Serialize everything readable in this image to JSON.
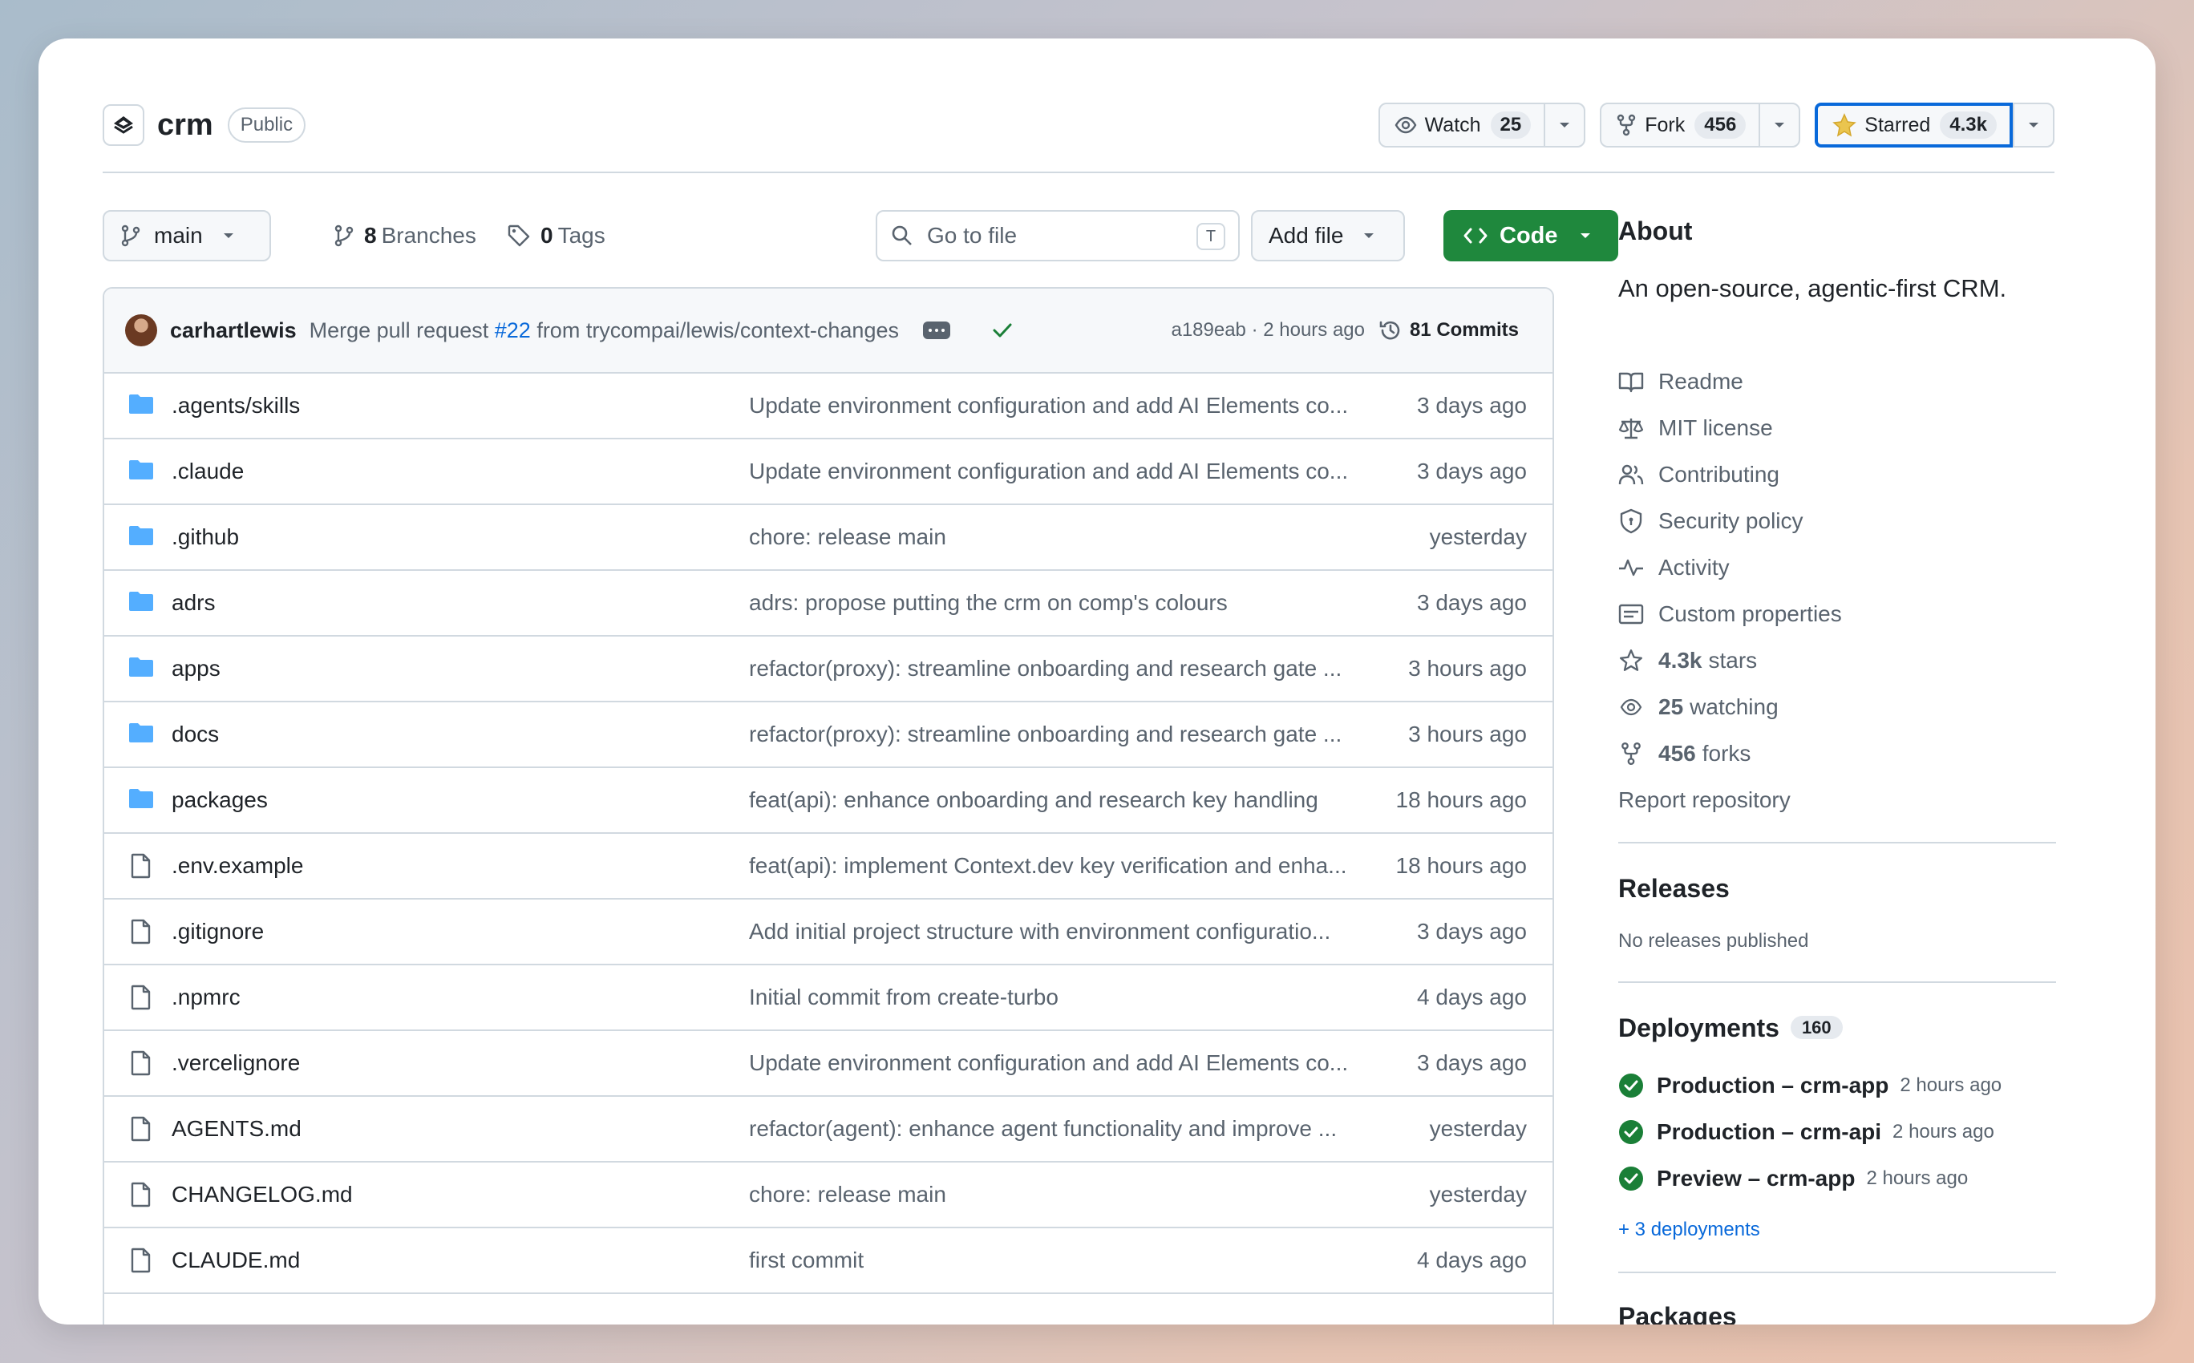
{
  "header": {
    "repo_name": "crm",
    "visibility": "Public",
    "watch": {
      "label": "Watch",
      "count": "25"
    },
    "fork": {
      "label": "Fork",
      "count": "456"
    },
    "star": {
      "label": "Starred",
      "count": "4.3k"
    }
  },
  "toolbar": {
    "branch": "main",
    "branches_count": "8",
    "branches_label": "Branches",
    "tags_count": "0",
    "tags_label": "Tags",
    "search_placeholder": "Go to file",
    "search_shortcut": "T",
    "add_file": "Add file",
    "code": "Code"
  },
  "commit": {
    "author": "carhartlewis",
    "message_prefix": "Merge pull request",
    "pr": "#22",
    "message_suffix": "from trycompai/lewis/context-changes",
    "sha_time": "a189eab · 2 hours ago",
    "commits": "81 Commits"
  },
  "files": [
    {
      "name": ".agents/skills",
      "type": "folder",
      "message": "Update environment configuration and add AI Elements co...",
      "time": "3 days ago"
    },
    {
      "name": ".claude",
      "type": "folder",
      "message": "Update environment configuration and add AI Elements co...",
      "time": "3 days ago"
    },
    {
      "name": ".github",
      "type": "folder",
      "message": "chore: release main",
      "time": "yesterday"
    },
    {
      "name": "adrs",
      "type": "folder",
      "message": "adrs: propose putting the crm on comp's colours",
      "time": "3 days ago"
    },
    {
      "name": "apps",
      "type": "folder",
      "message": "refactor(proxy): streamline onboarding and research gate ...",
      "time": "3 hours ago"
    },
    {
      "name": "docs",
      "type": "folder",
      "message": "refactor(proxy): streamline onboarding and research gate ...",
      "time": "3 hours ago"
    },
    {
      "name": "packages",
      "type": "folder",
      "message": "feat(api): enhance onboarding and research key handling",
      "time": "18 hours ago"
    },
    {
      "name": ".env.example",
      "type": "file",
      "message": "feat(api): implement Context.dev key verification and enha...",
      "time": "18 hours ago"
    },
    {
      "name": ".gitignore",
      "type": "file",
      "message": "Add initial project structure with environment configuratio...",
      "time": "3 days ago"
    },
    {
      "name": ".npmrc",
      "type": "file",
      "message": "Initial commit from create-turbo",
      "time": "4 days ago"
    },
    {
      "name": ".vercelignore",
      "type": "file",
      "message": "Update environment configuration and add AI Elements co...",
      "time": "3 days ago"
    },
    {
      "name": "AGENTS.md",
      "type": "file",
      "message": "refactor(agent): enhance agent functionality and improve ...",
      "time": "yesterday"
    },
    {
      "name": "CHANGELOG.md",
      "type": "file",
      "message": "chore: release main",
      "time": "yesterday"
    },
    {
      "name": "CLAUDE.md",
      "type": "file",
      "message": "first commit",
      "time": "4 days ago"
    }
  ],
  "about": {
    "title": "About",
    "description": "An open-source, agentic-first CRM.",
    "links": {
      "readme": "Readme",
      "license": "MIT license",
      "contributing": "Contributing",
      "security": "Security policy",
      "activity": "Activity",
      "custom_properties": "Custom properties",
      "stars_count": "4.3k",
      "stars_label": "stars",
      "watching_count": "25",
      "watching_label": "watching",
      "forks_count": "456",
      "forks_label": "forks",
      "report": "Report repository"
    }
  },
  "releases": {
    "title": "Releases",
    "empty": "No releases published"
  },
  "deployments": {
    "title": "Deployments",
    "count": "160",
    "items": [
      {
        "name": "Production – crm-app",
        "time": "2 hours ago"
      },
      {
        "name": "Production – crm-api",
        "time": "2 hours ago"
      },
      {
        "name": "Preview – crm-app",
        "time": "2 hours ago"
      }
    ],
    "more": "+ 3 deployments"
  },
  "packages": {
    "title": "Packages"
  },
  "colors": {
    "accent_blue": "#0969da",
    "code_green": "#1f883d",
    "folder_blue": "#54aeff",
    "success_green": "#1a7f37"
  }
}
